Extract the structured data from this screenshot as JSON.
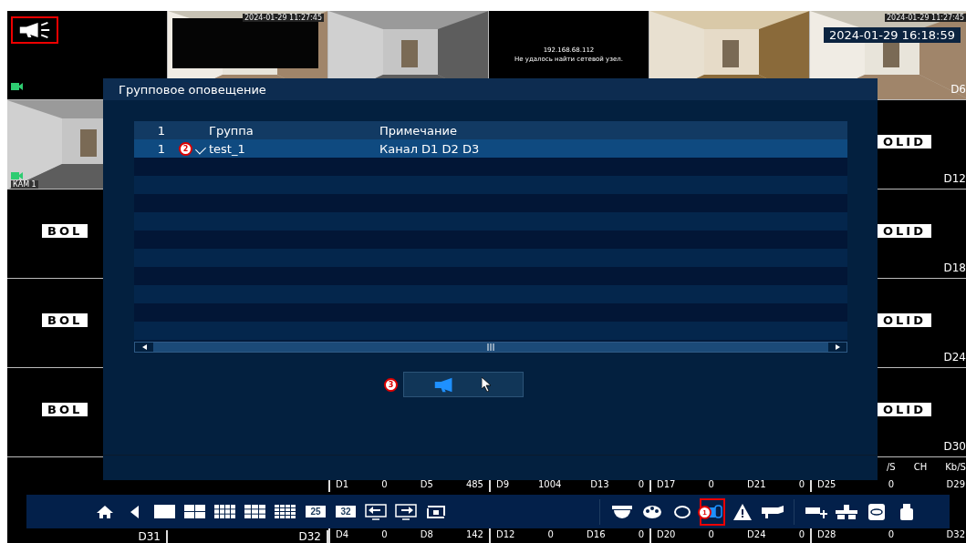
{
  "video_wall": {
    "rows": [
      {
        "tiles": [
          {
            "kind": "blank",
            "highlighted": true
          },
          {
            "kind": "picture",
            "timestamp": "2024-01-29 11:27:45"
          },
          {
            "kind": "picture"
          },
          {
            "kind": "error",
            "address": "192.168.68.112",
            "message": "Не удалось найти сетевой узел."
          },
          {
            "kind": "picture"
          },
          {
            "kind": "picture",
            "timestamp": "2024-01-29 11:27:45",
            "osd_time": "2024-01-29 16:18:59",
            "channel": "D6"
          }
        ]
      },
      {
        "tiles": [
          {
            "kind": "picture",
            "label": "КАМ 1"
          },
          {
            "kind": "logo",
            "logo": "OLID",
            "channel": "D12"
          }
        ]
      },
      {
        "tiles": [
          {
            "kind": "logo",
            "logo": "BOL"
          },
          {
            "kind": "logo",
            "logo": "OLID",
            "channel": "D18"
          }
        ]
      },
      {
        "tiles": [
          {
            "kind": "logo",
            "logo": "BOL"
          },
          {
            "kind": "logo",
            "logo": "OLID",
            "channel": "D24"
          }
        ]
      },
      {
        "tiles": [
          {
            "kind": "logo",
            "logo": "BOL"
          },
          {
            "kind": "logo",
            "logo": "OLID",
            "channel": "D30"
          }
        ]
      }
    ]
  },
  "stats": {
    "header": [
      "/S",
      "CH",
      "Kb/S"
    ],
    "left_labels": [
      "D31",
      "D32"
    ],
    "rows": [
      [
        [
          "D1",
          "0",
          "D5",
          "485"
        ],
        [
          "D9",
          "1004",
          "D13",
          "0"
        ],
        [
          "D17",
          "0",
          "D21",
          "0"
        ],
        [
          "D25",
          "0",
          "D29"
        ]
      ],
      [
        [
          "D4",
          "0",
          "D8",
          "142"
        ],
        [
          "D12",
          "0",
          "D16",
          "0"
        ],
        [
          "D20",
          "0",
          "D24",
          "0"
        ],
        [
          "D28",
          "0",
          "D32"
        ]
      ]
    ]
  },
  "dialog": {
    "title": "Групповое оповещение",
    "table": {
      "columns": [
        "1",
        "Группа",
        "Примечание"
      ],
      "rows": [
        {
          "index": "1",
          "marker": "2",
          "checked": true,
          "group": "test_1",
          "note": "Канал D1 D2 D3",
          "selected": true
        }
      ]
    },
    "button": {
      "marker": "3"
    }
  },
  "toolbar": {
    "items": [
      {
        "kind": "home",
        "selected": false
      },
      {
        "kind": "back",
        "selected": false
      },
      {
        "kind": "layout-1",
        "selected": false
      },
      {
        "kind": "layout-4",
        "selected": false
      },
      {
        "kind": "layout-8",
        "selected": false
      },
      {
        "kind": "layout-9",
        "selected": false
      },
      {
        "kind": "layout-16",
        "selected": false
      },
      {
        "kind": "layout-n",
        "label": "25",
        "selected": false
      },
      {
        "kind": "layout-n",
        "label": "32",
        "selected": false
      },
      {
        "kind": "screen-prev",
        "selected": false
      },
      {
        "kind": "screen-next",
        "selected": false
      },
      {
        "kind": "sequence",
        "selected": false
      },
      {
        "kind": "separator"
      },
      {
        "kind": "dome",
        "selected": false
      },
      {
        "kind": "palette",
        "selected": false
      },
      {
        "kind": "ring",
        "selected": false
      },
      {
        "kind": "intercom",
        "selected": true,
        "marker": "1"
      },
      {
        "kind": "alarm",
        "selected": false
      },
      {
        "kind": "camera",
        "selected": false
      },
      {
        "kind": "separator"
      },
      {
        "kind": "add-camera",
        "selected": false
      },
      {
        "kind": "network",
        "selected": false
      },
      {
        "kind": "disk",
        "selected": false
      },
      {
        "kind": "usb",
        "selected": false
      }
    ]
  }
}
